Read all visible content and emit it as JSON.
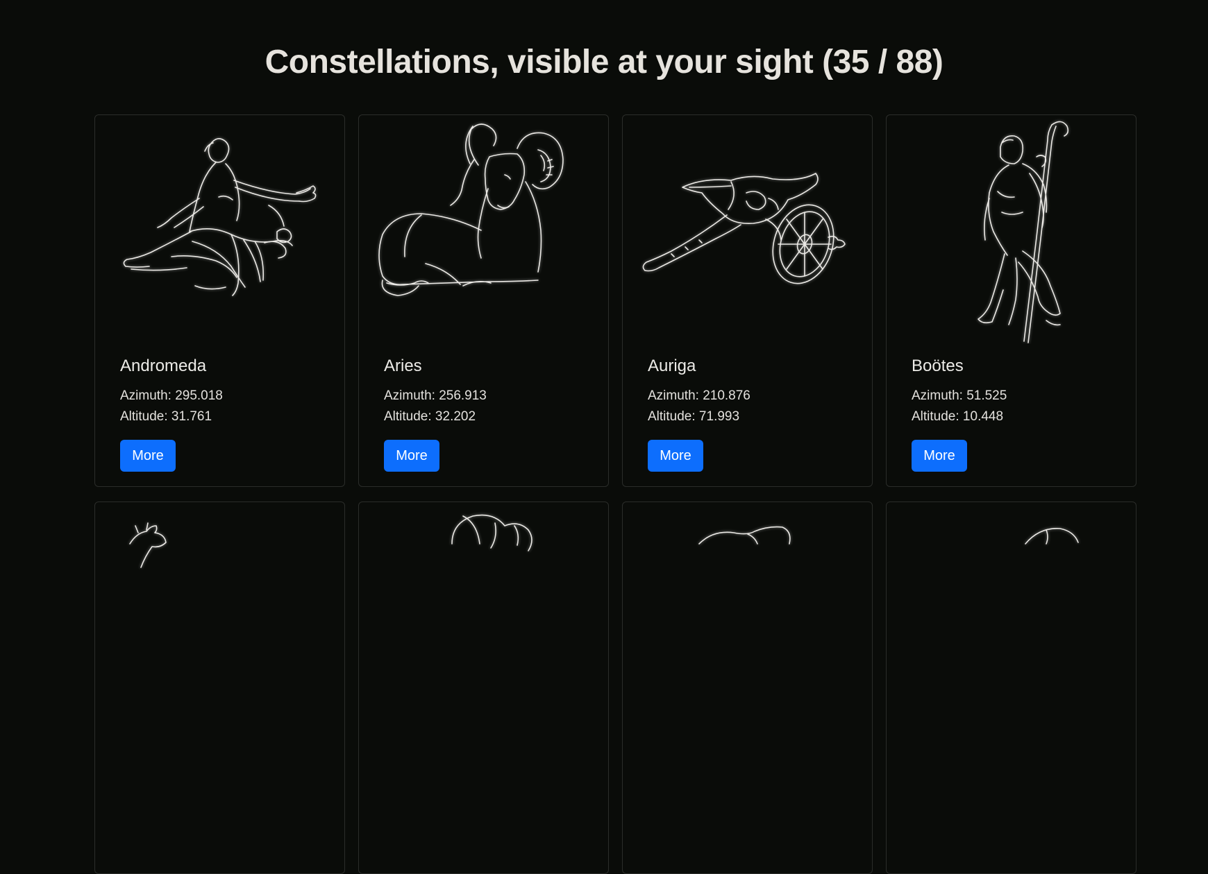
{
  "page": {
    "title": "Constellations, visible at your sight (35 / 88)"
  },
  "labels": {
    "azimuth_prefix": "Azimuth: ",
    "altitude_prefix": "Altitude: ",
    "more_button": "More"
  },
  "cards": [
    {
      "name": "Andromeda",
      "azimuth": "Azimuth: 295.018",
      "altitude": "Altitude: 31.761",
      "more": "More",
      "icon": "andromeda-figure"
    },
    {
      "name": "Aries",
      "azimuth": "Azimuth: 256.913",
      "altitude": "Altitude: 32.202",
      "more": "More",
      "icon": "ram-figure"
    },
    {
      "name": "Auriga",
      "azimuth": "Azimuth: 210.876",
      "altitude": "Altitude: 71.993",
      "more": "More",
      "icon": "chariot-figure"
    },
    {
      "name": "Boötes",
      "azimuth": "Azimuth: 51.525",
      "altitude": "Altitude: 10.448",
      "more": "More",
      "icon": "herdsman-figure"
    }
  ],
  "colors": {
    "background": "#0a0c09",
    "card_border": "#2b2d2a",
    "button": "#0d6efd",
    "text": "#e9e6e1"
  }
}
